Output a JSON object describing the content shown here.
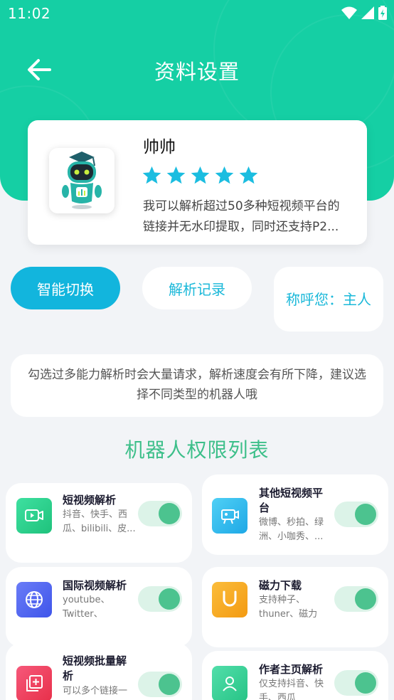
{
  "status_bar": {
    "time": "11:02"
  },
  "header": {
    "title": "资料设置"
  },
  "bot": {
    "name": "帅帅",
    "rating": 5,
    "description_line1": "我可以解析超过50多种短视频平台的",
    "description_line2": "链接并无水印提取，同时还支持P2..."
  },
  "actions": {
    "smart_switch": "智能切换",
    "parse_records": "解析记录",
    "call_me": "称呼您：主人"
  },
  "notice": "勾选过多能力解析时会大量请求，解析速度会有所下降，建议选择不同类型的机器人哦",
  "section_title": "机器人权限列表",
  "permissions": [
    {
      "name": "短视频解析",
      "desc": "抖音、快手、西瓜、bilibili、皮...",
      "icon": "video-icon",
      "color": "#2fd08f",
      "enabled": true
    },
    {
      "name": "其他短视频平台",
      "desc": "微博、秒拍、绿洲、小咖秀、...",
      "icon": "camera-icon",
      "color": "#2fb8ea",
      "enabled": true
    },
    {
      "name": "国际视频解析",
      "desc": "youtube、Twitter、tiktok...",
      "icon": "globe-icon",
      "color": "#4b63f0",
      "enabled": true
    },
    {
      "name": "磁力下载",
      "desc": "支持种子、thuner、磁力链...",
      "icon": "magnet-icon",
      "color": "#f6a823",
      "enabled": true
    },
    {
      "name": "短视频批量解析",
      "desc": "可以多个链接一",
      "icon": "batch-icon",
      "color": "#f0405e",
      "enabled": true
    },
    {
      "name": "作者主页解析",
      "desc": "仅支持抖音、快手、西瓜",
      "icon": "user-icon",
      "color": "#3ccf96",
      "enabled": true
    }
  ]
}
